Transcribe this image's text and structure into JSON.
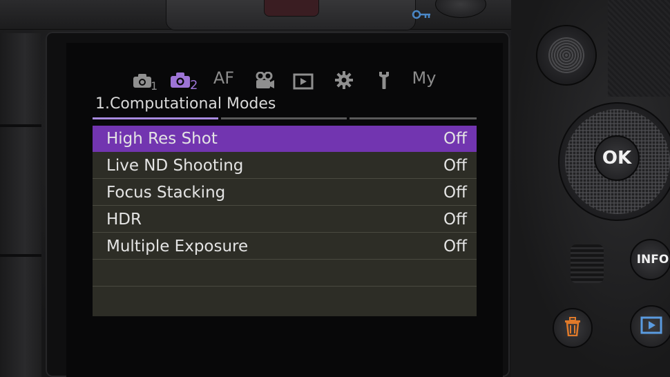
{
  "camera": {
    "ok_label": "OK",
    "info_label": "INFO",
    "accent_color": "#7235b0",
    "icons": [
      "lock-icon",
      "trash-icon",
      "playback-icon"
    ]
  },
  "menu": {
    "tabs": [
      {
        "icon": "shooting-menu-1-icon",
        "sub": "1",
        "active": false
      },
      {
        "icon": "shooting-menu-2-icon",
        "sub": "2",
        "active": true
      },
      {
        "label": "AF",
        "active": false
      },
      {
        "icon": "video-menu-icon",
        "active": false
      },
      {
        "icon": "playback-menu-icon",
        "active": false
      },
      {
        "icon": "custom-menu-gear-icon",
        "active": false
      },
      {
        "icon": "setup-menu-wrench-icon",
        "active": false
      },
      {
        "label": "My",
        "active": false
      }
    ],
    "page_title": "1.Computational Modes",
    "page_count": 3,
    "active_page": 1,
    "items": [
      {
        "label": "High Res Shot",
        "value": "Off",
        "selected": true
      },
      {
        "label": "Live ND Shooting",
        "value": "Off",
        "selected": false
      },
      {
        "label": "Focus Stacking",
        "value": "Off",
        "selected": false
      },
      {
        "label": "HDR",
        "value": "Off",
        "selected": false
      },
      {
        "label": "Multiple Exposure",
        "value": "Off",
        "selected": false
      }
    ]
  }
}
